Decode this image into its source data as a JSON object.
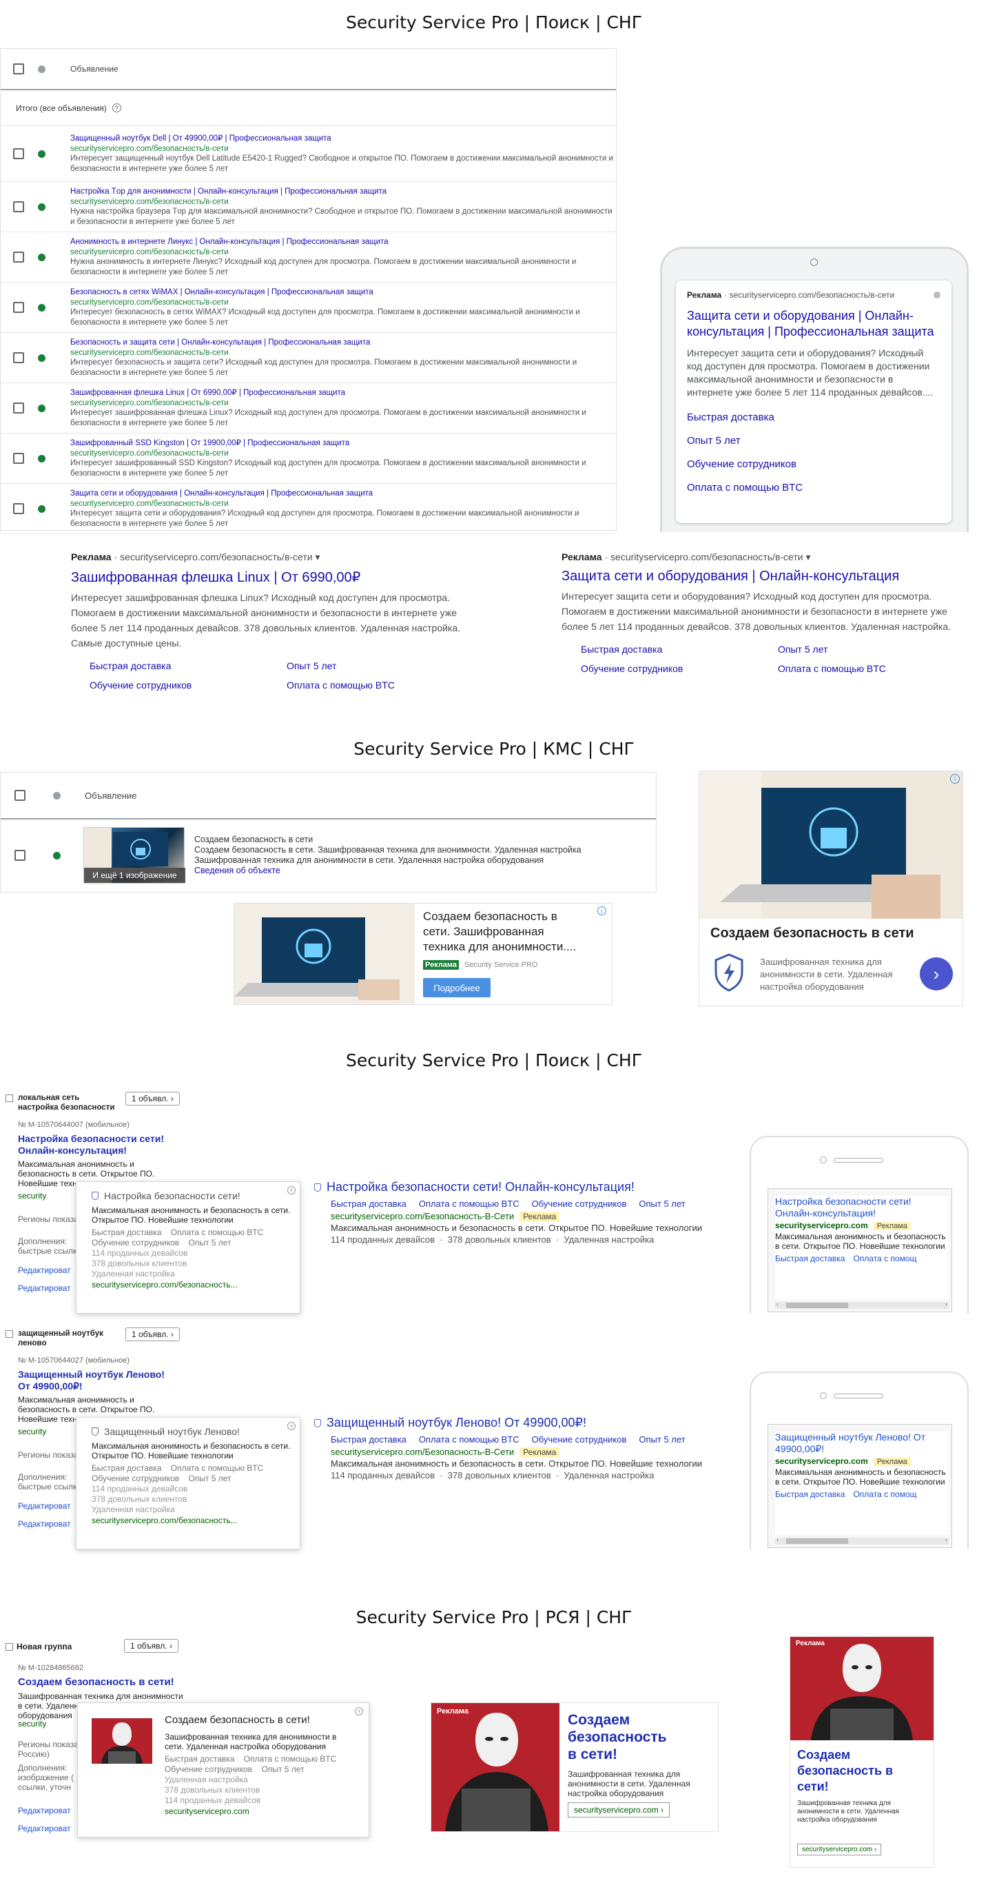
{
  "section1": {
    "title": "Security Service Pro | Поиск | СНГ",
    "table": {
      "header_col": "Объявление",
      "total_label": "Итого (все объявления)",
      "rows": [
        {
          "headline": "Защищенный ноутбук Dell | От 49900,00₽ | Профессиональная защита",
          "url": "securityservicepro.com/безопасность/в-сети",
          "desc": "Интересует защищенный ноутбук Dell Latitude E5420-1 Rugged? Свободное и открытое ПО. Помогаем в достижении максимальной анонимности и безопасности в интернете уже более 5 лет"
        },
        {
          "headline": "Настройка Tор для анонимности | Онлайн-консультация | Профессиональная защита",
          "url": "securityservicepro.com/безопасность/в-сети",
          "desc": "Нужна настройка браузера Tор для максимальной анонимности? Свободное и открытое ПО. Помогаем в достижении максимальной анонимности и безопасности в интернете уже более 5 лет"
        },
        {
          "headline": "Анонимность в интернете Линукс | Онлайн-консультация | Профессиональная защита",
          "url": "securityservicepro.com/безопасность/в-сети",
          "desc": "Нужна анонимность в интернете Линукс? Исходный код доступен для просмотра. Помогаем в достижении максимальной анонимности и безопасности в интернете уже более 5 лет"
        },
        {
          "headline": "Безопасность в сетях WiMAX | Онлайн-консультация | Профессиональная защита",
          "url": "securityservicepro.com/безопасность/в-сети",
          "desc": "Интересует безопасность в сетях WiMAX? Исходный код доступен для просмотра. Помогаем в достижении максимальной анонимности и безопасности в интернете уже более 5 лет"
        },
        {
          "headline": "Безопасность и защита сети | Онлайн-консультация | Профессиональная защита",
          "url": "securityservicepro.com/безопасность/в-сети",
          "desc": "Интересует безопасность и защита сети? Исходный код доступен для просмотра. Помогаем в достижении максимальной анонимности и безопасности в интернете уже более 5 лет"
        },
        {
          "headline": "Зашифрованная флешка Linux | От 6990,00₽ | Профессиональная защита",
          "url": "securityservicepro.com/безопасность/в-сети",
          "desc": "Интересует зашифрованная флешка Linux? Исходный код доступен для просмотра. Помогаем в достижении максимальной анонимности и безопасности в интернете уже более 5 лет"
        },
        {
          "headline": "Зашифрованный SSD Kingston | От 19900,00₽ | Профессиональная защита",
          "url": "securityservicepro.com/безопасность/в-сети",
          "desc": "Интересует зашифрованный SSD Kingston? Исходный код доступен для просмотра. Помогаем в достижении максимальной анонимности и безопасности в интернете уже более 5 лет"
        },
        {
          "headline": "Защита сети и оборудования | Онлайн-консультация | Профессиональная защита",
          "url": "securityservicepro.com/безопасность/в-сети",
          "desc": "Интересует защита сети и оборудования? Исходный код доступен для просмотра. Помогаем в достижении максимальной анонимности и безопасности в интернете уже более 5 лет"
        }
      ]
    },
    "mobile": {
      "ad_label": "Реклама",
      "url": "· securityservicepro.com/безопасность/в-сети",
      "headline": "Защита сети и оборудования | Онлайн-консультация | Профессиональная защита",
      "desc": "Интересует защита сети и оборудования? Исходный код доступен для просмотра. Помогаем в достижении максимальной анонимности и безопасности в интернете уже более 5 лет 114 проданных девайсов....",
      "links": [
        "Быстрая доставка",
        "Опыт 5 лет",
        "Обучение сотрудников",
        "Оплата с помощью BTC"
      ]
    },
    "desktop_ads": [
      {
        "ad_label": "Реклама",
        "url": "· securityservicepro.com/безопасность/в-сети ▾",
        "headline": "Зашифрованная флешка Linux | От 6990,00₽",
        "desc": "Интересует зашифрованная флешка Linux? Исходный код доступен для просмотра. Помогаем в достижении максимальной анонимности и безопасности в интернете уже более 5 лет 114 проданных девайсов. 378 довольных клиентов. Удаленная настройка. Самые доступные цены.",
        "links": [
          "Быстрая доставка",
          "Опыт 5 лет",
          "Обучение сотрудников",
          "Оплата с помощью BTC"
        ]
      },
      {
        "ad_label": "Реклама",
        "url": "· securityservicepro.com/безопасность/в-сети ▾",
        "headline": "Защита сети и оборудования | Онлайн-консультация",
        "desc": "Интересует защита сети и оборудования? Исходный код доступен для просмотра. Помогаем в достижении максимальной анонимности и безопасности в интернете уже более 5 лет 114 проданных девайсов. 378 довольных клиентов. Удаленная настройка.",
        "links": [
          "Быстрая доставка",
          "Опыт 5 лет",
          "Обучение сотрудников",
          "Оплата с помощью BTC"
        ]
      }
    ]
  },
  "section2": {
    "title": "Security Service Pro | КМС | СНГ",
    "table": {
      "header_col": "Объявление",
      "row_lines": [
        "Создаем безопасность в сети",
        "Создаем безопасность в сети. Зашифрованная техника для анонимности. Удаленная настройка",
        "Зашифрованная техника для анонимности в сети. Удаленная настройка оборудования"
      ],
      "details_link": "Сведения об объекте",
      "more_images": "И ещё 1 изображение"
    },
    "banner_small": {
      "text": "Создаем безопасность в сети. Зашифрованная техника для анонимности....",
      "badge": "Реклама",
      "brand": "Security Service PRO",
      "button": "Подробнее"
    },
    "banner_large": {
      "title": "Создаем безопасность в сети",
      "desc": "Зашифрованная техника для анонимности в сети. Удаленная настройка оборудования"
    }
  },
  "section3": {
    "title": "Security Service Pro | Поиск | СНГ",
    "groups": [
      {
        "group_name": "локальная сеть настройка безопасности",
        "count_btn": "1 объявл. ›",
        "id": "№ M-10570644007 (мобильное)",
        "side_title": "Настройка безопасности сети! Онлайн-консультация!",
        "side_text": "Максимальная анонимность и безопасность в сети. Открытое ПО. Новейшие технологии",
        "side_url": "security",
        "regions": "Регионы показа",
        "additions": "Дополнения:",
        "additions_more": "быстрые ссылк",
        "edit1": "Редактироват",
        "edit2": "Редактироват",
        "popup": {
          "title": "Настройка безопасности сети!",
          "text": "Максимальная анонимность и безопасность в сети. Открытое ПО. Новейшие технологии",
          "links1": "Быстрая доставка    Оплата с помощью BTC",
          "links2": "Обучение сотрудников    Опыт 5 лет",
          "extra1": "114 проданных девайсов",
          "extra2": "378 довольных клиентов",
          "extra3": "Удаленная настройка",
          "url": "securityservicepro.com/безопасность..."
        },
        "serp": {
          "title": "Настройка безопасности сети! Онлайн-консультация!",
          "links": [
            "Быстрая доставка",
            "Оплата с помощью BTC",
            "Обучение сотрудников",
            "Опыт 5 лет"
          ],
          "url": "securityservicepro.com/Безопасность-В-Сети",
          "badge": "Реклама",
          "text": "Максимальная анонимность и безопасность в сети. Открытое ПО. Новейшие технологии",
          "extra": "114 проданных девайсов  ·  378 довольных клиентов  ·  Удаленная настройка"
        },
        "mobile": {
          "title": "Настройка безопасности сети! Онлайн-консультация!",
          "url": "securityservicepro.com",
          "badge": "Реклама",
          "text": "Максимальная анонимность и безопасность в сети. Открытое ПО. Новейшие технологии",
          "link1": "Быстрая доставка",
          "link2": "Оплата с помощ"
        }
      },
      {
        "group_name": "защищенный ноутбук леново",
        "count_btn": "1 объявл. ›",
        "id": "№ M-10570644027 (мобильное)",
        "side_title": "Защищенный ноутбук Леново! От 49900,00₽!",
        "side_text": "Максимальная анонимность и безопасность в сети. Открытое ПО. Новейшие технологии",
        "side_url": "security",
        "regions": "Регионы показа",
        "additions": "Дополнения:",
        "additions_more": "быстрые ссылк",
        "edit1": "Редактироват",
        "edit2": "Редактироват",
        "popup": {
          "title": "Защищенный ноутбук Леново!",
          "text": "Максимальная анонимность и безопасность в сети. Открытое ПО. Новейшие технологии",
          "links1": "Быстрая доставка    Оплата с помощью BTC",
          "links2": "Обучение сотрудников    Опыт 5 лет",
          "extra1": "114 проданных девайсов",
          "extra2": "378 довольных клиентов",
          "extra3": "Удаленная настройка",
          "url": "securityservicepro.com/безопасность..."
        },
        "serp": {
          "title": "Защищенный ноутбук Леново! От 49900,00₽!",
          "links": [
            "Быстрая доставка",
            "Оплата с помощью BTC",
            "Обучение сотрудников",
            "Опыт 5 лет"
          ],
          "url": "securityservicepro.com/Безопасность-В-Сети",
          "badge": "Реклама",
          "text": "Максимальная анонимность и безопасность в сети. Открытое ПО. Новейшие технологии",
          "extra": "114 проданных девайсов  ·  378 довольных клиентов  ·  Удаленная настройка"
        },
        "mobile": {
          "title": "Защищенный ноутбук Леново! От 49900,00₽!",
          "url": "securityservicepro.com",
          "badge": "Реклама",
          "text": "Максимальная анонимность и безопасность в сети. Открытое ПО. Новейшие технологии",
          "link1": "Быстрая доставка",
          "link2": "Оплата с помощ"
        }
      }
    ]
  },
  "section4": {
    "title": "Security Service Pro | РСЯ | СНГ",
    "group_name": "Новая группа",
    "count_btn": "1 объявл. ›",
    "id": "№ M-10284865662",
    "side_title": "Создаем безопасность в сети!",
    "side_text": "Зашифрованная техника для анонимности в сети. Удаленная настройка оборудования",
    "side_url": "security",
    "regions": "Регионы показа",
    "regions_more": "Россию)",
    "additions": "Дополнения:",
    "additions_more": "изображение (",
    "additions_more2": "ссылки, уточн",
    "edit1": "Редактироват",
    "edit2": "Редактироват",
    "popup": {
      "title": "Создаем безопасность в сети!",
      "text": "Зашифрованная техника для анонимности в сети. Удаленная настройка оборудования",
      "links1": "Быстрая доставка    Оплата с помощью BTC",
      "links2": "Обучение сотрудников    Опыт 5 лет",
      "extra1": "Удаленная настройка",
      "extra2": "378 довольных клиентов",
      "extra3": "114 проданных девайсов",
      "url": "securityservicepro.com"
    },
    "banner_h": {
      "badge": "Реклама",
      "title": "Создаем безопасность в сети!",
      "text": "Зашифрованная техника для анонимности в сети. Удаленная настройка оборудования",
      "url": "securityservicepro.com ›"
    },
    "banner_v": {
      "badge": "Реклама",
      "title": "Создаем безопасность в сети!",
      "text": "Зашифрованная техника для анонимности в сети. Удаленная настройка оборудования",
      "url": "securityservicepro.com ›"
    }
  },
  "colors": {
    "link_blue": "#1a0dab",
    "url_green": "#188038",
    "yandex_green": "#006000",
    "yandex_badge": "#fff2b3",
    "button_blue": "#4a90e2"
  }
}
